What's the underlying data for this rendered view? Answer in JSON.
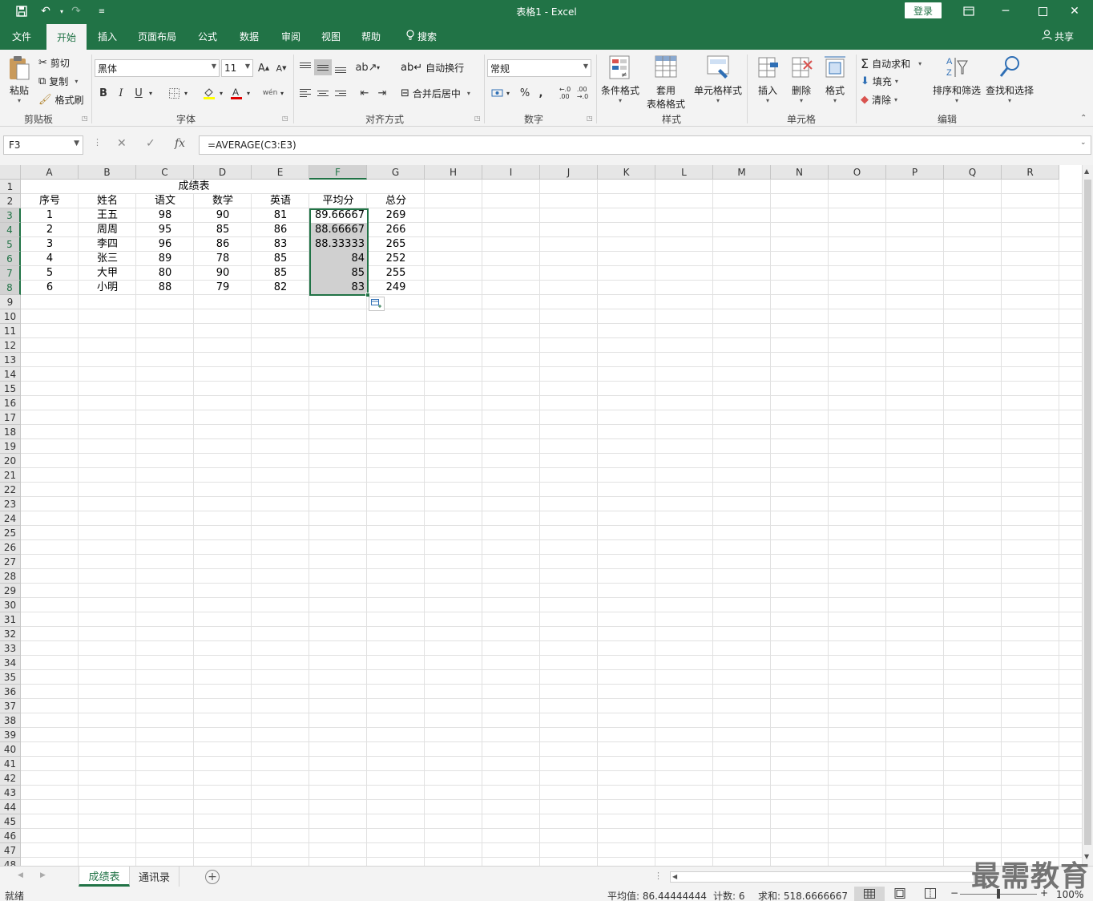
{
  "window": {
    "title": "表格1  -  Excel",
    "login_label": "登录"
  },
  "menu": {
    "tabs": [
      "文件",
      "开始",
      "插入",
      "页面布局",
      "公式",
      "数据",
      "审阅",
      "视图",
      "帮助"
    ],
    "search_label": "搜索",
    "share_label": "共享"
  },
  "ribbon": {
    "clipboard": {
      "paste": "粘贴",
      "cut": "剪切",
      "copy": "复制",
      "format_painter": "格式刷",
      "label": "剪贴板"
    },
    "font": {
      "family": "黑体",
      "size": "11",
      "bold": "B",
      "italic": "I",
      "underline": "U",
      "label": "字体"
    },
    "alignment": {
      "wrap": "自动换行",
      "merge": "合并后居中",
      "label": "对齐方式"
    },
    "number": {
      "format": "常规",
      "percent": "%",
      "comma": ",",
      "label": "数字"
    },
    "styles": {
      "conditional": "条件格式",
      "table_line1": "套用",
      "table_line2": "表格格式",
      "cell_styles": "单元格样式",
      "label": "样式"
    },
    "cells": {
      "insert": "插入",
      "delete": "删除",
      "format": "格式",
      "label": "单元格"
    },
    "editing": {
      "autosum": "自动求和",
      "fill": "填充",
      "clear": "清除",
      "sort": "排序和筛选",
      "find": "查找和选择",
      "label": "编辑"
    }
  },
  "formula_bar": {
    "name_box": "F3",
    "formula": "=AVERAGE(C3:E3)",
    "fx": "fx"
  },
  "sheet": {
    "columns": [
      "A",
      "B",
      "C",
      "D",
      "E",
      "F",
      "G",
      "H",
      "I",
      "J",
      "K",
      "L",
      "M",
      "N",
      "O",
      "P",
      "Q",
      "R"
    ],
    "row_count": 48,
    "selected_column": "F",
    "title": "成绩表",
    "headers": [
      "序号",
      "姓名",
      "语文",
      "数学",
      "英语",
      "平均分",
      "总分"
    ],
    "rows": [
      [
        "1",
        "王五",
        "98",
        "90",
        "81",
        "89.66667",
        "269"
      ],
      [
        "2",
        "周周",
        "95",
        "85",
        "86",
        "88.66667",
        "266"
      ],
      [
        "3",
        "李四",
        "96",
        "86",
        "83",
        "88.33333",
        "265"
      ],
      [
        "4",
        "张三",
        "89",
        "78",
        "85",
        "84",
        "252"
      ],
      [
        "5",
        "大甲",
        "80",
        "90",
        "85",
        "85",
        "255"
      ],
      [
        "6",
        "小明",
        "88",
        "79",
        "82",
        "83",
        "249"
      ]
    ]
  },
  "sheet_tabs": {
    "tabs": [
      "成绩表",
      "通讯录"
    ],
    "active": "成绩表"
  },
  "status": {
    "ready": "就绪",
    "average": "平均值: 86.44444444",
    "count": "计数: 6",
    "sum": "求和: 518.6666667",
    "zoom": "100%"
  },
  "watermark": "最需教育",
  "colors": {
    "accent": "#217346",
    "selection_fill": "#d0d0d0"
  }
}
